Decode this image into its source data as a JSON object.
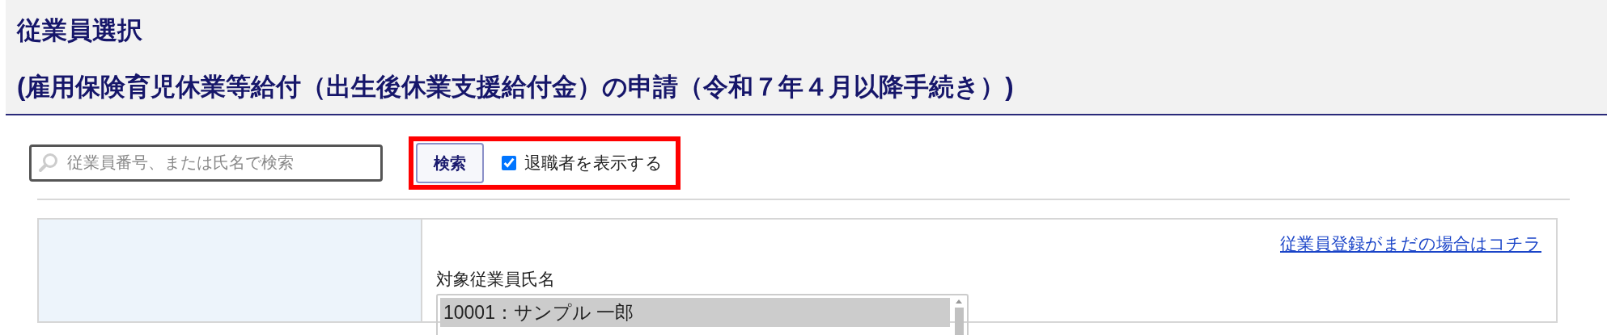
{
  "header": {
    "title": "従業員選択",
    "subtitle": "(雇用保険育児休業等給付（出生後休業支援給付金）の申請（令和７年４月以降手続き）)"
  },
  "search": {
    "placeholder": "従業員番号、または氏名で検索",
    "button": "検索",
    "show_retired": {
      "label": "退職者を表示する",
      "checked": true
    },
    "highlighted": true
  },
  "form": {
    "register_link": "従業員登録がまだの場合はコチラ",
    "employee_label": "対象従業員氏名",
    "employees": [
      {
        "label": "10001：サンプル 一郎",
        "selected": true
      }
    ]
  }
}
